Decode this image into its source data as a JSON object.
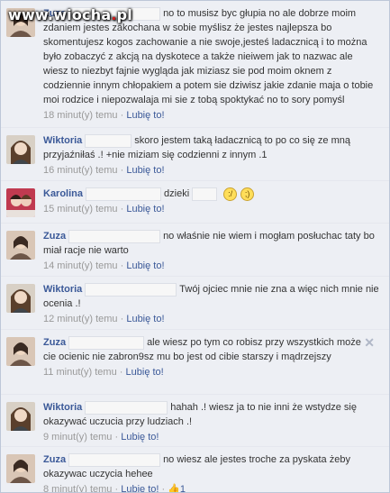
{
  "watermark": {
    "prefix": "www.",
    "site": "wiocha",
    "dot": ".",
    "tld": "pl"
  },
  "meta_labels": {
    "like": "Lubię to!",
    "separator": "·"
  },
  "comments": [
    {
      "author": "Zuza",
      "text": "no to musisz byc głupia no ale dobrze moim zdaniem jestes zakochana w sobie myślisz że jestes najlepsza bo skomentujesz kogos zachowanie a nie swoje,jesteś ladacznicą i to można było zobaczyć z akcją na dyskotece a także nieiwem jak to nazwac ale wiesz to niezbyt fajnie wygląda jak miziasz sie pod moim oknem z codziennie innym chłopakiem a potem sie dziwisz jakie zdanie maja o tobie moi rodzice i niepozwalaja mi sie z tobą spoktykać no to sory pomyśl",
      "time": "18 minut(y) temu"
    },
    {
      "author": "Wiktoria",
      "text": "skoro jestem taką ładacznicą to po co się ze mną przyjaźniłaś .! +nie miziam się codzienni z innym .1",
      "time": "16 minut(y) temu"
    },
    {
      "author": "Karolina",
      "text": "dzieki",
      "time": "15 minut(y) temu"
    },
    {
      "author": "Zuza",
      "text": "no właśnie nie wiem i mogłam posłuchac taty bo miał racje nie warto",
      "time": "14 minut(y) temu"
    },
    {
      "author": "Wiktoria",
      "text": "Twój ojciec mnie nie zna a więc nich mnie nie ocenia .!",
      "time": "12 minut(y) temu"
    },
    {
      "author": "Zuza",
      "text": "ale wiesz po tym co robisz przy wszystkich może cie ocienic nie zabron9sz mu bo jest od cibie starszy i mądrzejszy",
      "time": "11 minut(y) temu"
    },
    {
      "author": "Wiktoria",
      "text": "hahah .! wiesz ja to nie inni że wstydze się okazywać uczucia przy ludziach .!",
      "time": "9 minut(y) temu"
    },
    {
      "author": "Zuza",
      "text": "no wiesz ale jestes troche za pyskata żeby okazywac uczycia hehee",
      "time": "8 minut(y) temu",
      "like_count": "1"
    }
  ]
}
